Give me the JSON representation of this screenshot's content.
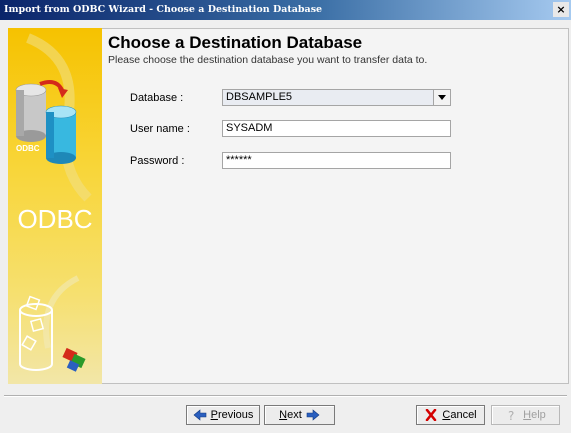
{
  "window": {
    "title": "Import from ODBC Wizard - Choose a Destination Database",
    "close_glyph": "×"
  },
  "banner": {
    "label_odbc_small": "ODBC",
    "label_odbc_large": "ODBC",
    "icons": [
      "database-transfer-icon",
      "connection-cylinder-icon"
    ]
  },
  "page": {
    "title": "Choose a Destination Database",
    "subtitle": "Please choose the destination database you want to transfer data to."
  },
  "form": {
    "database": {
      "label": "Database :",
      "value": "DBSAMPLE5"
    },
    "username": {
      "label": "User name :",
      "value": "SYSADM"
    },
    "password": {
      "label": "Password :",
      "value": "******"
    }
  },
  "buttons": {
    "previous": {
      "label_first": "P",
      "label_rest": "revious",
      "icon": "left-arrow-icon"
    },
    "next": {
      "label_first": "N",
      "label_rest": "ext",
      "icon": "right-arrow-icon"
    },
    "cancel": {
      "label_first": "C",
      "label_rest": "ancel",
      "icon": "red-x-icon"
    },
    "help": {
      "label_first": "H",
      "label_rest": "elp",
      "icon": "help-icon",
      "enabled": false
    }
  },
  "colors": {
    "title_bar_start": "#0a246a",
    "banner_yellow": "#f6c200",
    "cancel_red": "#d40000",
    "arrow_blue": "#2a5fbf"
  }
}
